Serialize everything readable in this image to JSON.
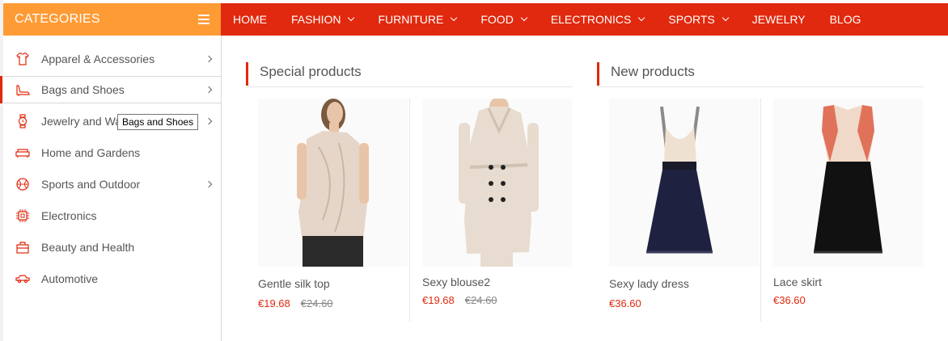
{
  "header": {
    "categories_title": "CATEGORIES",
    "menu_icon": "hamburger-icon"
  },
  "colors": {
    "accent_orange": "#ff9b35",
    "nav_red": "#e0290e",
    "price_red": "#e0290e"
  },
  "topnav": {
    "items": [
      {
        "label": "HOME",
        "dropdown": false
      },
      {
        "label": "FASHION",
        "dropdown": true
      },
      {
        "label": "FURNITURE",
        "dropdown": true
      },
      {
        "label": "FOOD",
        "dropdown": true
      },
      {
        "label": "ELECTRONICS",
        "dropdown": true
      },
      {
        "label": "SPORTS",
        "dropdown": true
      },
      {
        "label": "JEWELRY",
        "dropdown": false
      },
      {
        "label": "BLOG",
        "dropdown": false
      }
    ]
  },
  "sidebar": {
    "items": [
      {
        "label": "Apparel & Accessories",
        "icon": "tshirt-icon",
        "submenu": true
      },
      {
        "label": "Bags and Shoes",
        "icon": "shoe-icon",
        "submenu": true,
        "active": true
      },
      {
        "label": "Jewelry and Watches",
        "icon": "watch-icon",
        "submenu": true
      },
      {
        "label": "Home and Gardens",
        "icon": "sofa-icon",
        "submenu": false
      },
      {
        "label": "Sports and Outdoor",
        "icon": "ball-icon",
        "submenu": true
      },
      {
        "label": "Electronics",
        "icon": "chip-icon",
        "submenu": false
      },
      {
        "label": "Beauty and Health",
        "icon": "briefcase-icon",
        "submenu": false
      },
      {
        "label": "Automotive",
        "icon": "car-icon",
        "submenu": false
      }
    ],
    "tooltip": "Bags and Shoes"
  },
  "sections": {
    "special": {
      "title": "Special products",
      "products": [
        {
          "name": "Gentle silk top",
          "price": "€19.68",
          "old_price": "€24.60"
        },
        {
          "name": "Sexy blouse2",
          "price": "€19.68",
          "old_price": "€24.60"
        }
      ]
    },
    "new": {
      "title": "New products",
      "products": [
        {
          "name": "Sexy lady dress",
          "price": "€36.60"
        },
        {
          "name": "Lace skirt",
          "price": "€36.60"
        }
      ]
    }
  }
}
